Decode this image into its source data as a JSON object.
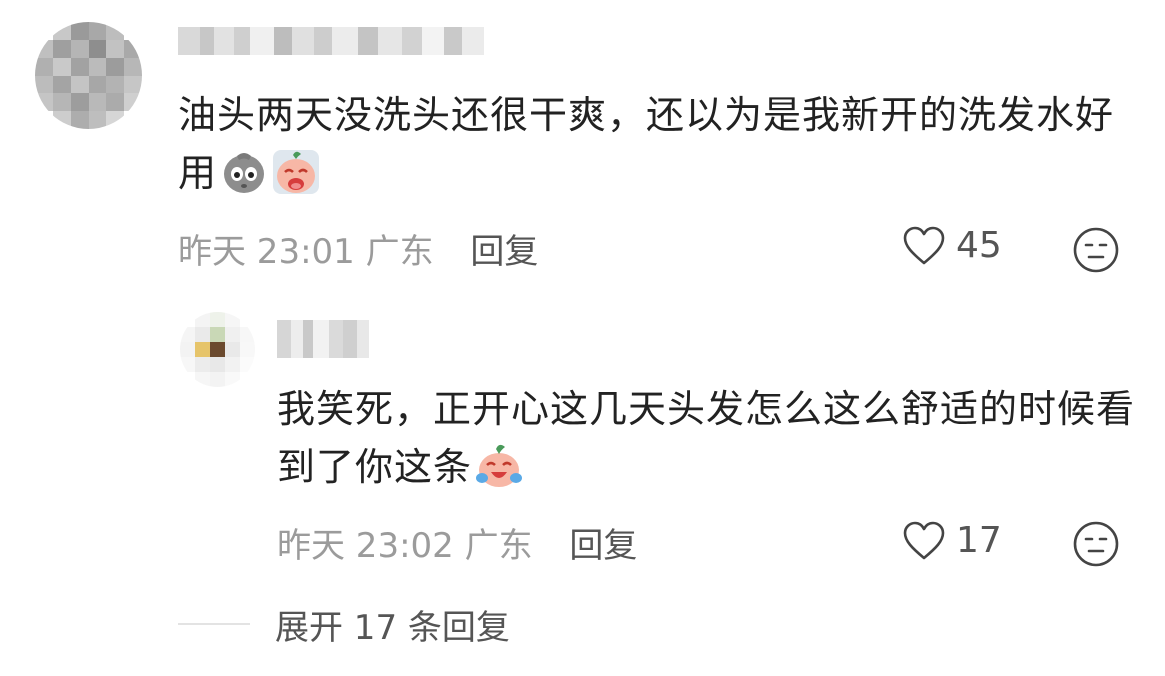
{
  "comments": [
    {
      "text": "油头两天没洗头还很干爽，还以为是我新开的洗发水好用",
      "emojis": [
        "rock-face-emoji",
        "crying-peach-emoji"
      ],
      "time": "昨天 23:01",
      "location": "广东",
      "reply_label": "回复",
      "likes": "45"
    }
  ],
  "reply": {
    "text": "我笑死，正开心这几天头发怎么这么舒适的时候看到了你这条",
    "emoji": "laughing-crying-peach-emoji",
    "time": "昨天 23:02",
    "location": "广东",
    "reply_label": "回复",
    "likes": "17"
  },
  "expand_label": "展开 17 条回复",
  "colors": {
    "text": "#222222",
    "meta": "#9b9b9b",
    "action": "#555555",
    "divider": "#e3e3e3"
  }
}
